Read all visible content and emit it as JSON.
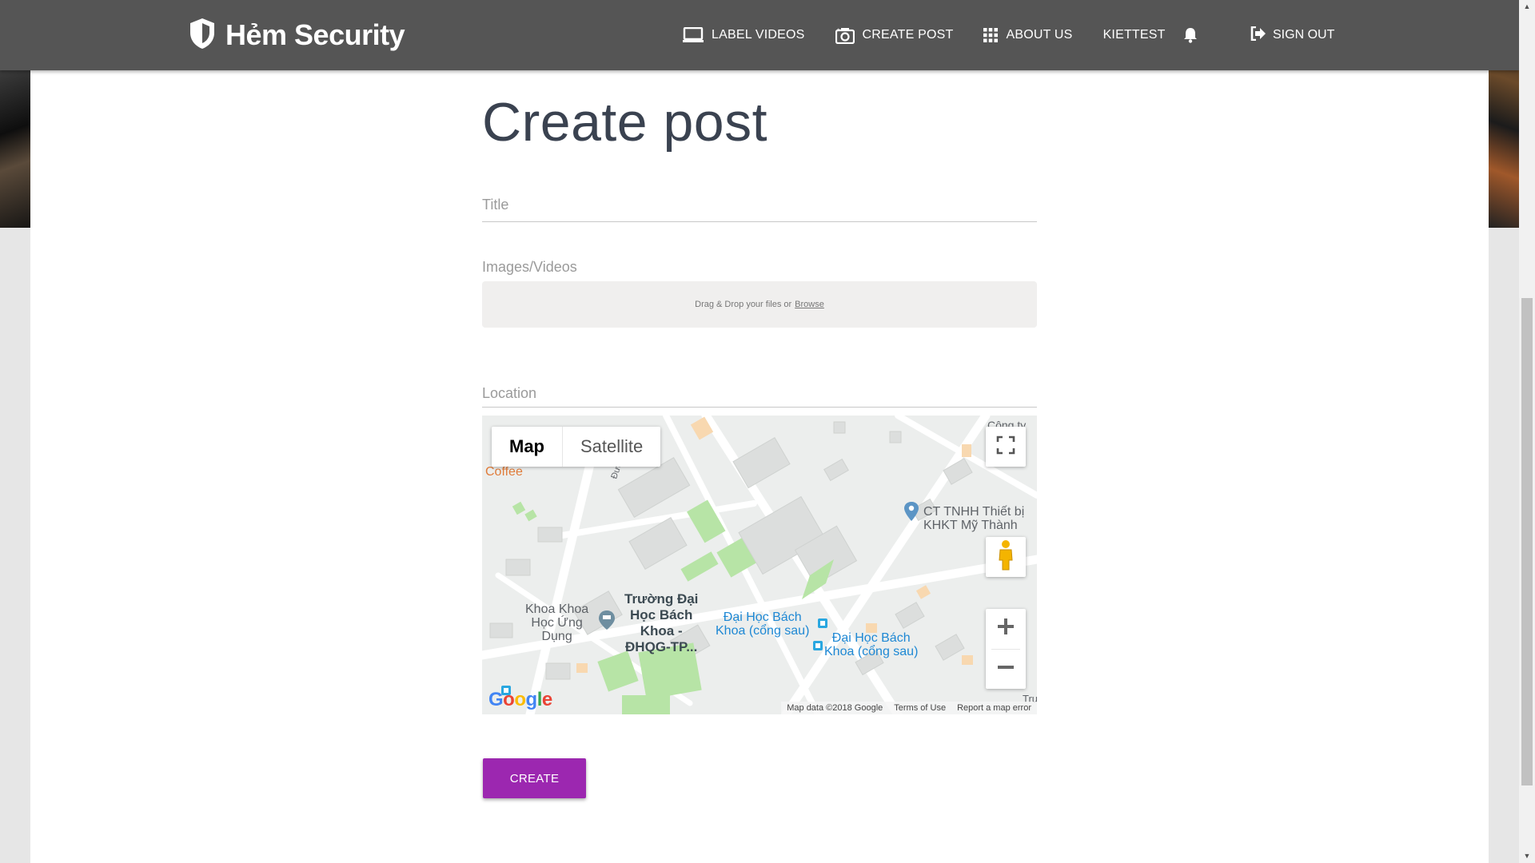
{
  "brand": {
    "name": "Hẻm Security"
  },
  "nav": {
    "items": [
      {
        "label": "LABEL VIDEOS",
        "icon": "laptop-icon"
      },
      {
        "label": "CREATE POST",
        "icon": "camera-icon"
      },
      {
        "label": "ABOUT US",
        "icon": "grid-icon"
      },
      {
        "label": "KIETTEST",
        "icon": "bell-icon"
      }
    ],
    "signout": {
      "label": "SIGN OUT",
      "icon": "signout-icon"
    }
  },
  "form": {
    "title": "Create post",
    "title_field": {
      "placeholder": "Title",
      "value": ""
    },
    "images_label": "Images/Videos",
    "dropzone": {
      "text": "Drag & Drop your files or",
      "browse": "Browse"
    },
    "location_field": {
      "placeholder": "Location",
      "value": ""
    },
    "submit_label": "CREATE"
  },
  "map": {
    "type_active": "Map",
    "type_inactive": "Satellite",
    "labels": {
      "coffee": "Coffee",
      "company_line1": "CT TNHH Thiết bị",
      "company_line2": "KHKT Mỹ Thành",
      "faculty_line1": "Khoa Khoa",
      "faculty_line2": "Học Ứng",
      "faculty_line3": "Dụng",
      "uni_line1": "Trường Đại",
      "uni_line2": "Học Bách",
      "uni_line3": "Khoa -",
      "uni_line4": "ĐHQG-TP...",
      "bus1_line1": "Đại Học Bách",
      "bus1_line2": "Khoa (cổng sau)",
      "bus2_line1": "Đại Học Bách",
      "bus2_line2": "Khoa (cổng sau)",
      "top_right": "Công ty",
      "street": "Đườ",
      "edge_right": "Tru"
    },
    "footer": {
      "data": "Map data ©2018 Google",
      "terms": "Terms of Use",
      "report": "Report a map error"
    },
    "logo": "Google"
  },
  "colors": {
    "navbar": "#555555",
    "accent": "#9c27b0",
    "title_text": "#3a4250"
  }
}
